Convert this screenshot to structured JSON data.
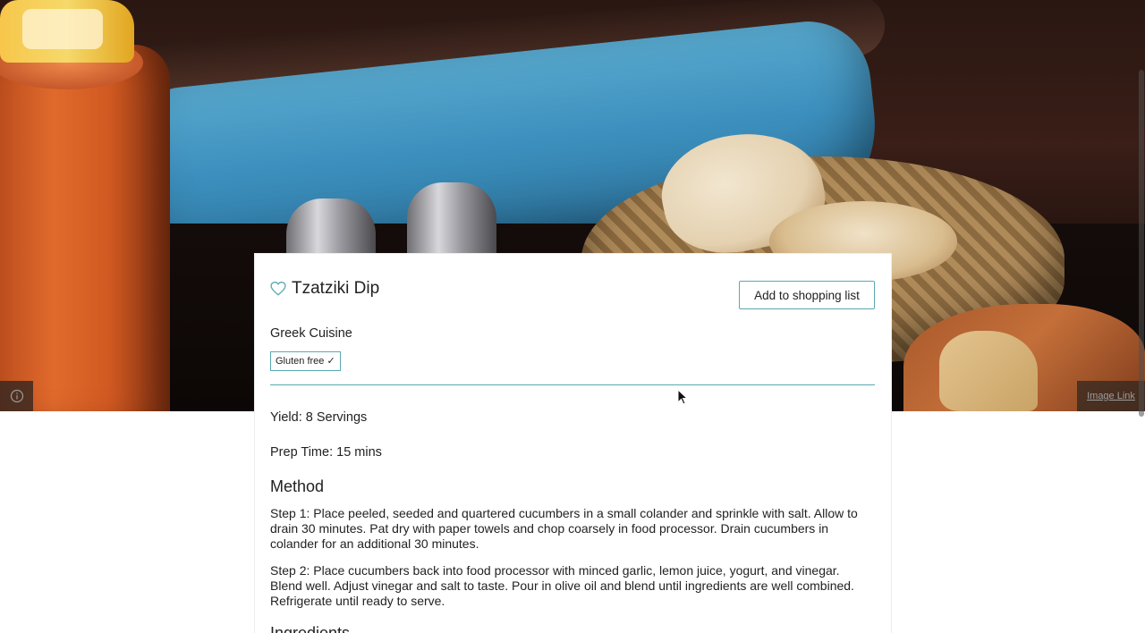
{
  "hero": {
    "image_link_label": "Image Link"
  },
  "recipe": {
    "title": "Tzatziki Dip",
    "add_button_label": "Add to shopping list",
    "cuisine": "Greek Cuisine",
    "badge": "Gluten free ✓",
    "yield": "Yield: 8 Servings",
    "prep_time": "Prep Time: 15 mins",
    "method_heading": "Method",
    "steps": [
      "Step 1: Place peeled, seeded and quartered cucumbers in a small colander and sprinkle with salt. Allow to drain 30 minutes. Pat dry with paper towels and chop coarsely in food processor. Drain cucumbers in colander for an additional 30 minutes.",
      "Step 2: Place cucumbers back into food processor with minced garlic, lemon juice, yogurt, and vinegar. Blend well. Adjust vinegar and salt to taste. Pour in olive oil and blend until ingredients are well combined. Refrigerate until ready to serve."
    ],
    "ingredients_heading": "Ingredients"
  },
  "colors": {
    "accent": "#5aa9b0",
    "text": "#222222"
  },
  "icons": {
    "info": "info-icon",
    "heart": "heart-icon",
    "cursor": "mouse-cursor-icon"
  }
}
